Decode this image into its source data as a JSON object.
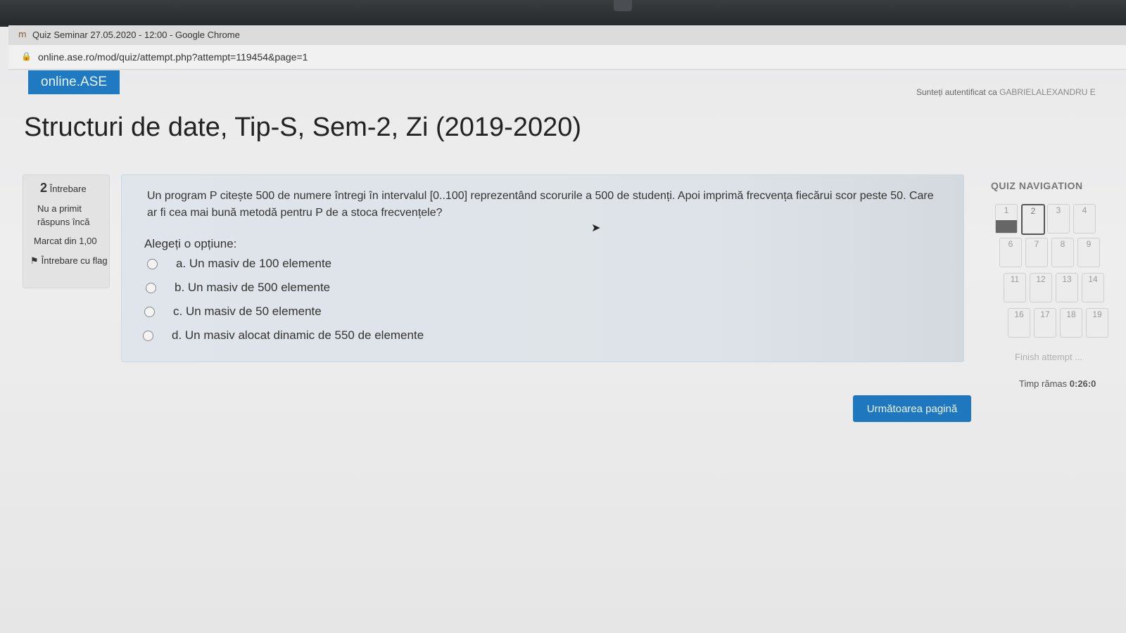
{
  "window": {
    "title": "Quiz Seminar 27.05.2020 - 12:00 - Google Chrome",
    "url": "online.ase.ro/mod/quiz/attempt.php?attempt=119454&page=1"
  },
  "header": {
    "brand": "online.ASE",
    "auth_label": "Sunteți autentificat ca",
    "auth_user": "GABRIELALEXANDRU E"
  },
  "course_title": "Structuri de date, Tip-S, Sem-2, Zi (2019-2020)",
  "question_info": {
    "number": "2",
    "label": "Întrebare",
    "state": "Nu a primit răspuns încă",
    "grade": "Marcat din 1,00",
    "flag_label": "Întrebare cu flag"
  },
  "question": {
    "text": "Un program P citește 500 de numere întregi în intervalul [0..100] reprezentând scorurile a 500 de studenți. Apoi imprimă frecvența fiecărui scor peste 50. Care ar fi cea mai bună metodă pentru P de a stoca frecvențele?",
    "prompt": "Alegeți o opțiune:",
    "options": [
      {
        "label": "a. Un masiv de 100 elemente"
      },
      {
        "label": "b. Un masiv de 500 elemente"
      },
      {
        "label": "c. Un masiv de 50 elemente"
      },
      {
        "label": "d. Un masiv alocat dinamic de 550 de elemente"
      }
    ]
  },
  "next_button": "Următoarea pagină",
  "quiz_nav": {
    "title": "QUIZ NAVIGATION",
    "buttons": [
      "1",
      "2",
      "3",
      "4",
      "6",
      "7",
      "8",
      "9",
      "11",
      "12",
      "13",
      "14",
      "16",
      "17",
      "18",
      "19"
    ],
    "answered": [
      "1"
    ],
    "current": "2",
    "finish": "Finish attempt ...",
    "timer_label": "Timp rămas",
    "timer_value": "0:26:0"
  },
  "icons": {
    "tab": "moodle-icon",
    "lock": "lock-icon",
    "flag": "flag-icon",
    "cursor": "mouse-pointer-icon"
  }
}
